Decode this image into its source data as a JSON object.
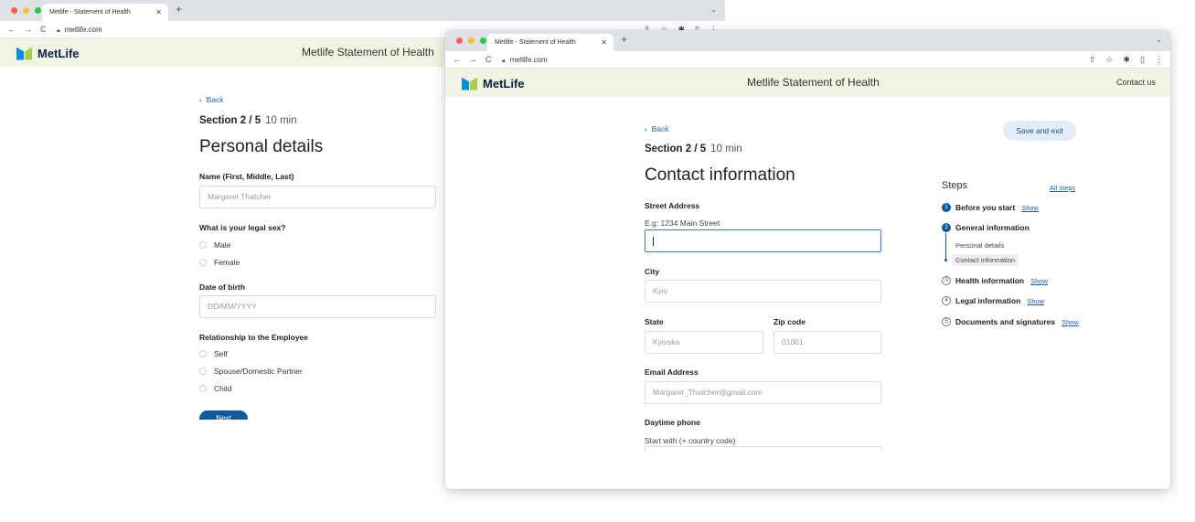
{
  "back_window": {
    "tab_title": "Metlife - Statement of Health",
    "url": "metlife.com",
    "brand": "MetLife",
    "header_title": "Metlife Statement of Health",
    "back_link": "Back",
    "section": "Section 2 / 5",
    "duration": "10 min",
    "page_title": "Personal details",
    "name_label": "Name (First, Middle, Last)",
    "name_value": "Margaret Thatcher",
    "sex_label": "What is your legal sex?",
    "sex_options": [
      "Male",
      "Female"
    ],
    "dob_label": "Date of birth",
    "dob_placeholder": "DD/MM/YYYY",
    "relationship_label": "Relationship to the Employee",
    "relationship_options": [
      "Self",
      "Spouse/Domestic Partner",
      "Child"
    ],
    "next_button": "Next"
  },
  "front_window": {
    "tab_title": "Metlife - Statement of Health",
    "url": "metlife.com",
    "brand": "MetLife",
    "header_title": "Metlife Statement of Health",
    "contact_us": "Contact us",
    "back_link": "Back",
    "section": "Section 2 / 5",
    "duration": "10 min",
    "page_title": "Contact information",
    "save_exit": "Save and exit",
    "street_label": "Street Address",
    "street_hint": "E.g: 1234 Main Street",
    "street_value": "",
    "city_label": "City",
    "city_placeholder": "Kyiv",
    "state_label": "State",
    "state_placeholder": "Kyivska",
    "zip_label": "Zip code",
    "zip_placeholder": "01001",
    "email_label": "Email Address",
    "email_placeholder": "Margaret_Thatcher@gmail.com",
    "phone_label": "Daytime phone",
    "phone_hint": "Start with (+ country code)",
    "steps": {
      "title": "Steps",
      "all_steps": "All steps",
      "show": "Show",
      "items": [
        {
          "num": "1",
          "label": "Before you start"
        },
        {
          "num": "2",
          "label": "General information"
        },
        {
          "num": "3",
          "label": "Health information"
        },
        {
          "num": "4",
          "label": "Legal information"
        },
        {
          "num": "5",
          "label": "Documents and signatures"
        }
      ],
      "substeps": [
        "Personal details",
        "Contact information"
      ]
    }
  },
  "colors": {
    "header_bg": "#f1f4e2",
    "primary": "#0e5a9c",
    "link": "#1a5fb4",
    "focus_border": "#3d7ad6",
    "logo_blue": "#0090da",
    "logo_green": "#a4ce4e"
  },
  "icons": [
    "close-icon",
    "plus-icon",
    "chevron-down-icon",
    "back-arrow-icon",
    "forward-arrow-icon",
    "reload-icon",
    "lock-icon",
    "share-icon",
    "star-icon",
    "puzzle-icon",
    "sidebar-icon",
    "more-icon",
    "chevron-left-icon"
  ]
}
